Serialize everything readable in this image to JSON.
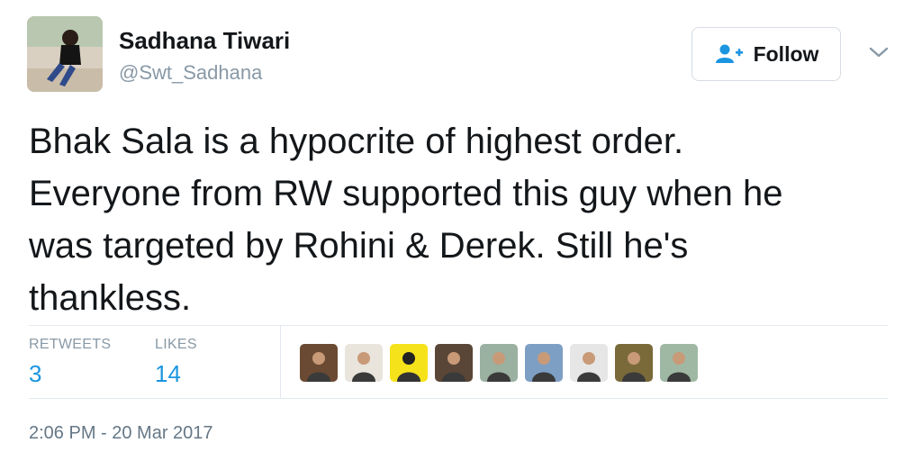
{
  "user": {
    "name": "Sadhana Tiwari",
    "handle": "@Swt_Sadhana"
  },
  "follow_button": {
    "label": "Follow",
    "icon": "add-user-icon"
  },
  "more_menu": {
    "icon": "chevron-down-icon"
  },
  "tweet": {
    "lines": [
      "Bhak Sala is a hypocrite of highest order.",
      "Everyone from RW supported this guy when he",
      "was targeted by Rohini & Derek. Still he's",
      "thankless."
    ]
  },
  "stats": {
    "retweets_label": "RETWEETS",
    "retweets_count": "3",
    "likes_label": "LIKES",
    "likes_count": "14"
  },
  "liker_avatars": [
    {
      "bg": "#6b4a33"
    },
    {
      "bg": "#e9e4dc"
    },
    {
      "bg": "#f6e21a"
    },
    {
      "bg": "#5a4636"
    },
    {
      "bg": "#9ab0a0"
    },
    {
      "bg": "#7d9fc4"
    },
    {
      "bg": "#e6e6e6"
    },
    {
      "bg": "#7a6a3a"
    },
    {
      "bg": "#9fb8a4"
    }
  ],
  "timestamp": "2:06 PM - 20 Mar 2017",
  "colors": {
    "link": "#1b95e0",
    "muted": "#8899a6",
    "follow_icon": "#1b95e0"
  }
}
